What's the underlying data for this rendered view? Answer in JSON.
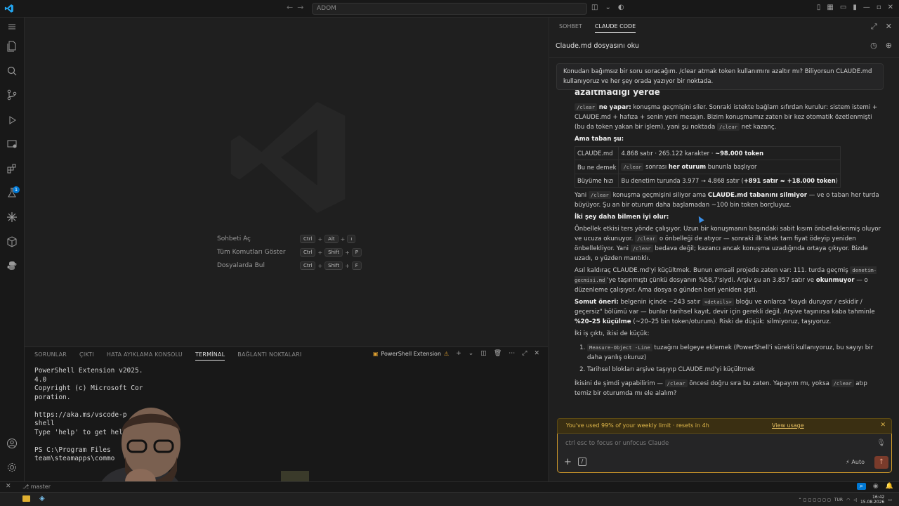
{
  "titlebar": {
    "search": "ADOM"
  },
  "editor": {
    "hints": [
      {
        "label": "Sohbeti Aç",
        "keys": [
          "Ctrl",
          "Alt",
          "ı"
        ]
      },
      {
        "label": "Tüm Komutları Göster",
        "keys": [
          "Ctrl",
          "Shift",
          "P"
        ]
      },
      {
        "label": "Dosyalarda Bul",
        "keys": [
          "Ctrl",
          "Shift",
          "F"
        ]
      }
    ]
  },
  "panel": {
    "tabs": [
      "SORUNLAR",
      "ÇIKTI",
      "HATA AYIKLAMA KONSOLU",
      "TERMİNAL",
      "BAĞLANTI NOKTALARI"
    ],
    "active_tab": "TERMİNAL",
    "ps_label": "PowerShell Extension",
    "terminal_lines": [
      "PowerShell Extension v2025.",
      "4.0",
      "Copyright (c) Microsoft Cor",
      "poration.",
      "",
      "https://aka.ms/vscode-p",
      "shell",
      "Type 'help' to get hel",
      "",
      "PS C:\\Program Files",
      "team\\steamapps\\commo"
    ]
  },
  "statusbar": {
    "branch": "master",
    "activity_badge": "1"
  },
  "taskbar": {
    "lang": "TUR",
    "time": "16:42",
    "date": "15.08.2026"
  },
  "claude": {
    "tabs": [
      "SOHBET",
      "CLAUDE CODE"
    ],
    "active_tab": "CLAUDE CODE",
    "title": "Claude.md dosyasını oku",
    "user_message": "Konudan bağımsız bir soru soracağım. /clear atmak token kullanımını azaltır mı? Biliyorsun CLAUDE.md kullanıyoruz ve her şey orada yazıyor bir noktada.",
    "heading": "azaltmadığı yerde",
    "p1_code": "/clear",
    "p1_bold": "ne yapar:",
    "p1_text": "konuşma geçmişini siler. Sonraki istekte bağlam sıfırdan kurulur: sistem istemi + CLAUDE.md + hafıza + senin yeni mesajın. Bizim konuşmamız zaten bir kez otomatik özetlenmişti (bu da token yakan bir işlem), yani şu noktada",
    "p1_code2": "/clear",
    "p1_tail": "net kazanç.",
    "ama_taban": "Ama taban şu:",
    "table": {
      "r1c1": "CLAUDE.md",
      "r1c2a": "4.868 satır · 265.122 karakter · ",
      "r1c2b": "~98.000 token",
      "r2c1": "Bu ne demek",
      "r2code": "/clear",
      "r2mid": "sonrası",
      "r2bold": "her oturum",
      "r2tail": "bununla başlıyor",
      "r3c1": "Büyüme hızı",
      "r3a": "Bu denetim turunda 3.977 → 4.868 satır (",
      "r3bold": "+891 satır ≈ +18.000 token",
      "r3tail": ")"
    },
    "p2_a": "Yani",
    "p2_code": "/clear",
    "p2_b": "konuşma geçmişini siliyor ama",
    "p2_bold": "CLAUDE.md tabanını silmiyor",
    "p2_c": "— ve o taban her turda büyüyor. Şu an bir oturum daha başlamadan ~100 bin token borçluyuz.",
    "iki_sey": "İki şey daha bilmen iyi olur:",
    "p3_a": "Önbellek etkisi ters yönde çalışıyor. Uzun bir konuşmanın başındaki sabit kısım önbelleklenmiş oluyor ve ucuza okunuyor.",
    "p3_code": "/clear",
    "p3_b": "o önbelleği de atıyor — sonraki ilk istek tam fiyat ödeyip yeniden önbellekliyor. Yani",
    "p3_code2": "/clear",
    "p3_c": "bedava değil; kazancı ancak konuşma uzadığında ortaya çıkıyor. Bizde uzadı, o yüzden mantıklı.",
    "p4_a": "Asıl kaldıraç CLAUDE.md'yi küçültmek. Bunun emsali projede zaten var: 111. turda geçmiş",
    "p4_code": "denetim-gecmisi.md",
    "p4_b": "'ye taşınmıştı çünkü dosyanın %58,7'siydi. Arşiv şu an 3.857 satır ve",
    "p4_bold": "okunmuyor",
    "p4_c": "— o düzenleme çalışıyor. Ama dosya o günden beri yeniden şişti.",
    "p5_bold": "Somut öneri:",
    "p5_a": "belgenin içinde ~243 satır",
    "p5_code": "<details>",
    "p5_b": "bloğu ve onlarca \"kaydı duruyor / eskidir / geçersiz\" bölümü var — bunlar tarihsel kayıt, devir için gerekli değil. Arşive taşınırsa kaba tahminle",
    "p5_bold2": "%20–25 küçülme",
    "p5_c": "(~20–25 bin token/oturum). Riski de düşük: silmiyoruz, taşıyoruz.",
    "p6": "İki iş çıktı, ikisi de küçük:",
    "li1_code": "Measure-Object -Line",
    "li1_text": "tuzağını belgeye eklemek (PowerShell'i sürekli kullanıyoruz, bu sayıyı bir daha yanlış okuruz)",
    "li2": "Tarihsel blokları arşive taşıyıp CLAUDE.md'yi küçültmek",
    "p7_a": "İkisini de şimdi yapabilirim —",
    "p7_code": "/clear",
    "p7_b": "öncesi doğru sıra bu zaten. Yapayım mı, yoksa",
    "p7_code2": "/clear",
    "p7_c": "atıp temiz bir oturumda mı ele alalım?",
    "limit_text": "You've used 99% of your weekly limit · resets in 4h",
    "limit_link": "View usage",
    "input_placeholder": "ctrl esc to focus or unfocus Claude",
    "mode": "Auto"
  },
  "colors": {
    "accent": "#0078d4",
    "warning": "#e0b84a",
    "send": "#7a3b2b"
  }
}
